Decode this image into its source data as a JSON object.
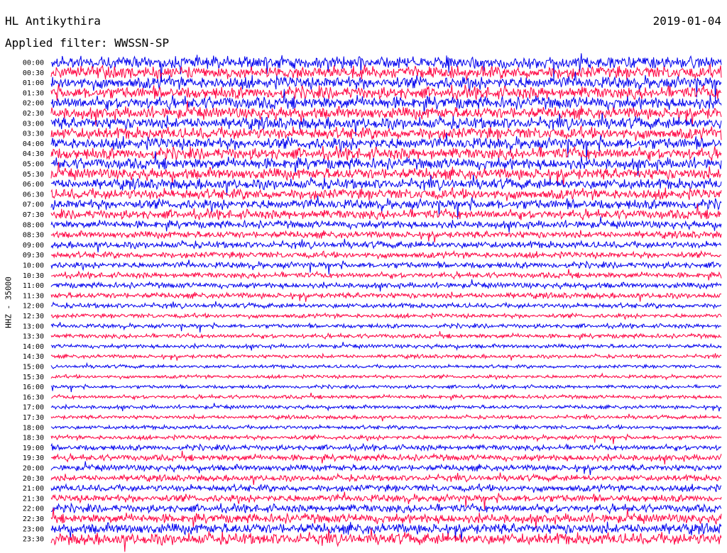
{
  "header": {
    "station": "HL Antikythira",
    "date": "2019-01-04",
    "filter": "Applied filter: WWSSN-SP"
  },
  "chart_data": {
    "type": "line",
    "title": "HL Antikythira",
    "date": "2019-01-04",
    "filter": "WWSSN-SP",
    "ylabel": "HHZ - 35000",
    "row_labels": [
      "00:00",
      "00:30",
      "01:00",
      "01:30",
      "02:00",
      "02:30",
      "03:00",
      "03:30",
      "04:00",
      "04:30",
      "05:00",
      "05:30",
      "06:00",
      "06:30",
      "07:00",
      "07:30",
      "08:00",
      "08:30",
      "09:00",
      "09:30",
      "10:00",
      "10:30",
      "11:00",
      "11:30",
      "12:00",
      "12:30",
      "13:00",
      "13:30",
      "14:00",
      "14:30",
      "15:00",
      "15:30",
      "16:00",
      "16:30",
      "17:00",
      "17:30",
      "18:00",
      "18:30",
      "19:00",
      "19:30",
      "20:00",
      "20:30",
      "21:00",
      "21:30",
      "22:00",
      "22:30",
      "23:00",
      "23:30"
    ],
    "row_amplitude": [
      1.0,
      1.0,
      1.0,
      1.0,
      1.0,
      0.95,
      0.95,
      0.95,
      0.95,
      0.95,
      0.9,
      0.9,
      0.85,
      0.85,
      0.8,
      0.75,
      0.6,
      0.55,
      0.55,
      0.5,
      0.5,
      0.45,
      0.45,
      0.45,
      0.4,
      0.35,
      0.35,
      0.35,
      0.32,
      0.3,
      0.28,
      0.28,
      0.28,
      0.3,
      0.3,
      0.3,
      0.32,
      0.35,
      0.45,
      0.5,
      0.5,
      0.5,
      0.55,
      0.6,
      0.65,
      0.75,
      0.85,
      0.95
    ],
    "colors": [
      "#0000ee",
      "#ff0040"
    ]
  }
}
